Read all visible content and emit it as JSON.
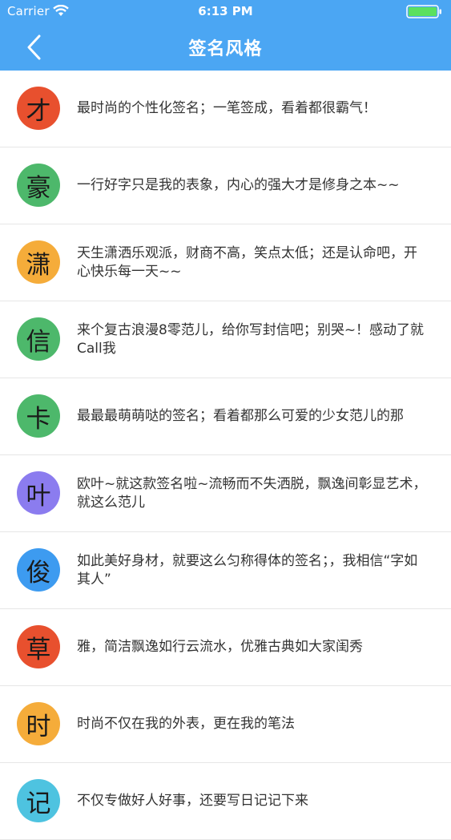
{
  "status_bar": {
    "carrier": "Carrier",
    "time": "6:13 PM",
    "icons": [
      "wifi-icon",
      "battery-icon"
    ]
  },
  "nav": {
    "title": "签名风格",
    "back_icon": "chevron-left-icon"
  },
  "styles": [
    {
      "glyph": "才",
      "color": "#E8502E",
      "text": "最时尚的个性化签名；一笔签成，看着都很霸气！"
    },
    {
      "glyph": "豪",
      "color": "#4DB86B",
      "text": "一行好字只是我的表象，内心的强大才是修身之本~~"
    },
    {
      "glyph": "潇",
      "color": "#F5AC3A",
      "text": "天生潇洒乐观派，财商不高，笑点太低；还是认命吧，开心快乐每一天~~"
    },
    {
      "glyph": "信",
      "color": "#4DB86B",
      "text": "来个复古浪漫8零范儿，给你写封信吧；别哭~！感动了就Call我"
    },
    {
      "glyph": "卡",
      "color": "#4DB86B",
      "text": "最最最萌萌哒的签名；看着都那么可爱的少女范儿的那"
    },
    {
      "glyph": "叶",
      "color": "#8B7CEF",
      "text": "欧叶~就这款签名啦~流畅而不失洒脱，飘逸间彰显艺术，就这么范儿"
    },
    {
      "glyph": "俊",
      "color": "#3D9BF0",
      "text": "如此美好身材，就要这么匀称得体的签名；，我相信“字如其人”"
    },
    {
      "glyph": "草",
      "color": "#E8502E",
      "text": "雅，简洁飘逸如行云流水，优雅古典如大家闺秀"
    },
    {
      "glyph": "时",
      "color": "#F5AC3A",
      "text": "时尚不仅在我的外表，更在我的笔法"
    },
    {
      "glyph": "记",
      "color": "#4EC3E0",
      "text": "不仅专做好人好事，还要写日记记下来"
    }
  ]
}
